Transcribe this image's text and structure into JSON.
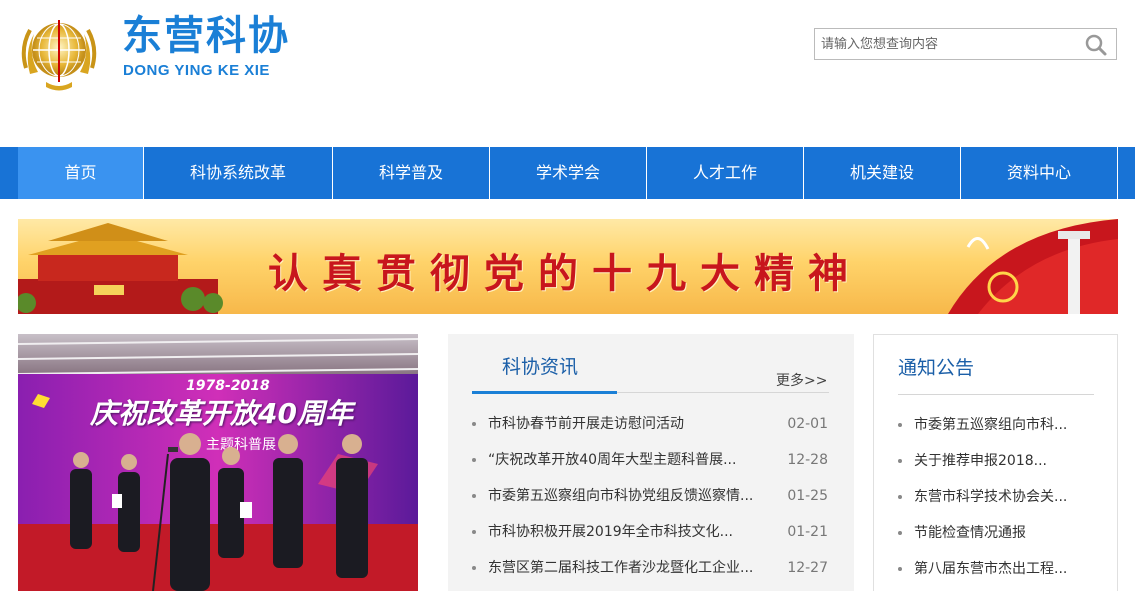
{
  "brand": {
    "title_cn": "东营科协",
    "title_en": "DONG YING KE XIE"
  },
  "search": {
    "placeholder": "请输入您想查询内容"
  },
  "nav": {
    "items": [
      {
        "label": "首页"
      },
      {
        "label": "科协系统改革"
      },
      {
        "label": "科学普及"
      },
      {
        "label": "学术学会"
      },
      {
        "label": "人才工作"
      },
      {
        "label": "机关建设"
      },
      {
        "label": "资料中心"
      }
    ]
  },
  "banner": {
    "slogan": "认真贯彻党的十九大精神"
  },
  "photo": {
    "banner_years": "1978-2018",
    "banner_text": "庆祝改革开放40周年",
    "banner_sub": "主题科普展"
  },
  "news": {
    "title": "科协资讯",
    "more_label": "更多>>",
    "items": [
      {
        "title": "市科协春节前开展走访慰问活动",
        "date": "02-01"
      },
      {
        "title": "“庆祝改革开放40周年大型主题科普展...",
        "date": "12-28"
      },
      {
        "title": "市委第五巡察组向市科协党组反馈巡察情...",
        "date": "01-25"
      },
      {
        "title": "市科协积极开展2019年全市科技文化...",
        "date": "01-21"
      },
      {
        "title": "东营区第二届科技工作者沙龙暨化工企业...",
        "date": "12-27"
      }
    ]
  },
  "notice": {
    "title": "通知公告",
    "items": [
      {
        "title": "市委第五巡察组向市科..."
      },
      {
        "title": "关于推荐申报2018..."
      },
      {
        "title": "东营市科学技术协会关..."
      },
      {
        "title": "节能检查情况通报"
      },
      {
        "title": "第八届东营市杰出工程..."
      }
    ]
  },
  "colors": {
    "brand_blue": "#1a7fd6",
    "nav_blue": "#1873d6",
    "nav_active": "#3a93f0",
    "banner_red": "#c8161d"
  }
}
